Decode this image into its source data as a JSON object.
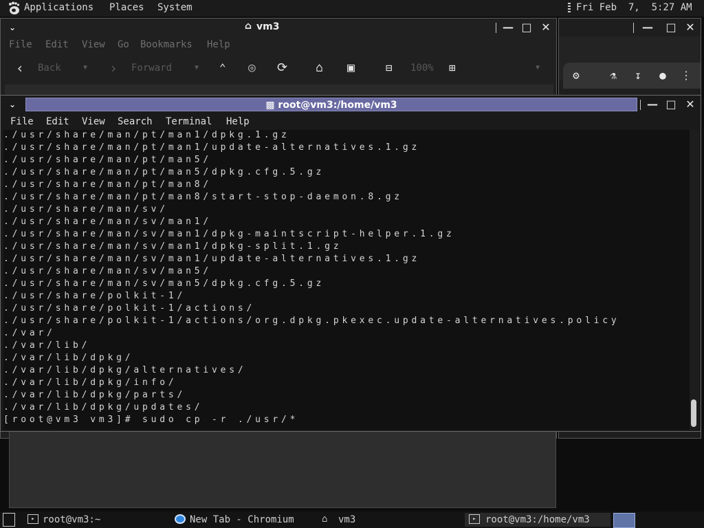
{
  "top_panel": {
    "menus": [
      "Applications",
      "Places",
      "System"
    ],
    "clock": "Fri Feb  7,  5:27 AM"
  },
  "file_manager": {
    "title": "vm3",
    "menus": [
      "File",
      "Edit",
      "View",
      "Go",
      "Bookmarks",
      "Help"
    ],
    "back_label": "Back",
    "forward_label": "Forward",
    "zoom_level": "100%"
  },
  "terminal": {
    "title": "root@vm3:/home/vm3",
    "menus": [
      "File",
      "Edit",
      "View",
      "Search",
      "Terminal",
      "Help"
    ],
    "lines": [
      "./usr/share/man/pt/man1/dpkg.1.gz",
      "./usr/share/man/pt/man1/update-alternatives.1.gz",
      "./usr/share/man/pt/man5/",
      "./usr/share/man/pt/man5/dpkg.cfg.5.gz",
      "./usr/share/man/pt/man8/",
      "./usr/share/man/pt/man8/start-stop-daemon.8.gz",
      "./usr/share/man/sv/",
      "./usr/share/man/sv/man1/",
      "./usr/share/man/sv/man1/dpkg-maintscript-helper.1.gz",
      "./usr/share/man/sv/man1/dpkg-split.1.gz",
      "./usr/share/man/sv/man1/update-alternatives.1.gz",
      "./usr/share/man/sv/man5/",
      "./usr/share/man/sv/man5/dpkg.cfg.5.gz",
      "./usr/share/polkit-1/",
      "./usr/share/polkit-1/actions/",
      "./usr/share/polkit-1/actions/org.dpkg.pkexec.update-alternatives.policy",
      "./var/",
      "./var/lib/",
      "./var/lib/dpkg/",
      "./var/lib/dpkg/alternatives/",
      "./var/lib/dpkg/info/",
      "./var/lib/dpkg/parts/",
      "./var/lib/dpkg/updates/",
      "[root@vm3 vm3]# sudo cp -r ./usr/*"
    ]
  },
  "taskbar": {
    "items": [
      "root@vm3:~",
      "New Tab - Chromium",
      "vm3",
      "root@vm3:/home/vm3"
    ]
  },
  "colors": {
    "terminal_title_active": "#6a6aa2",
    "workspace_active": "#6074a8"
  }
}
